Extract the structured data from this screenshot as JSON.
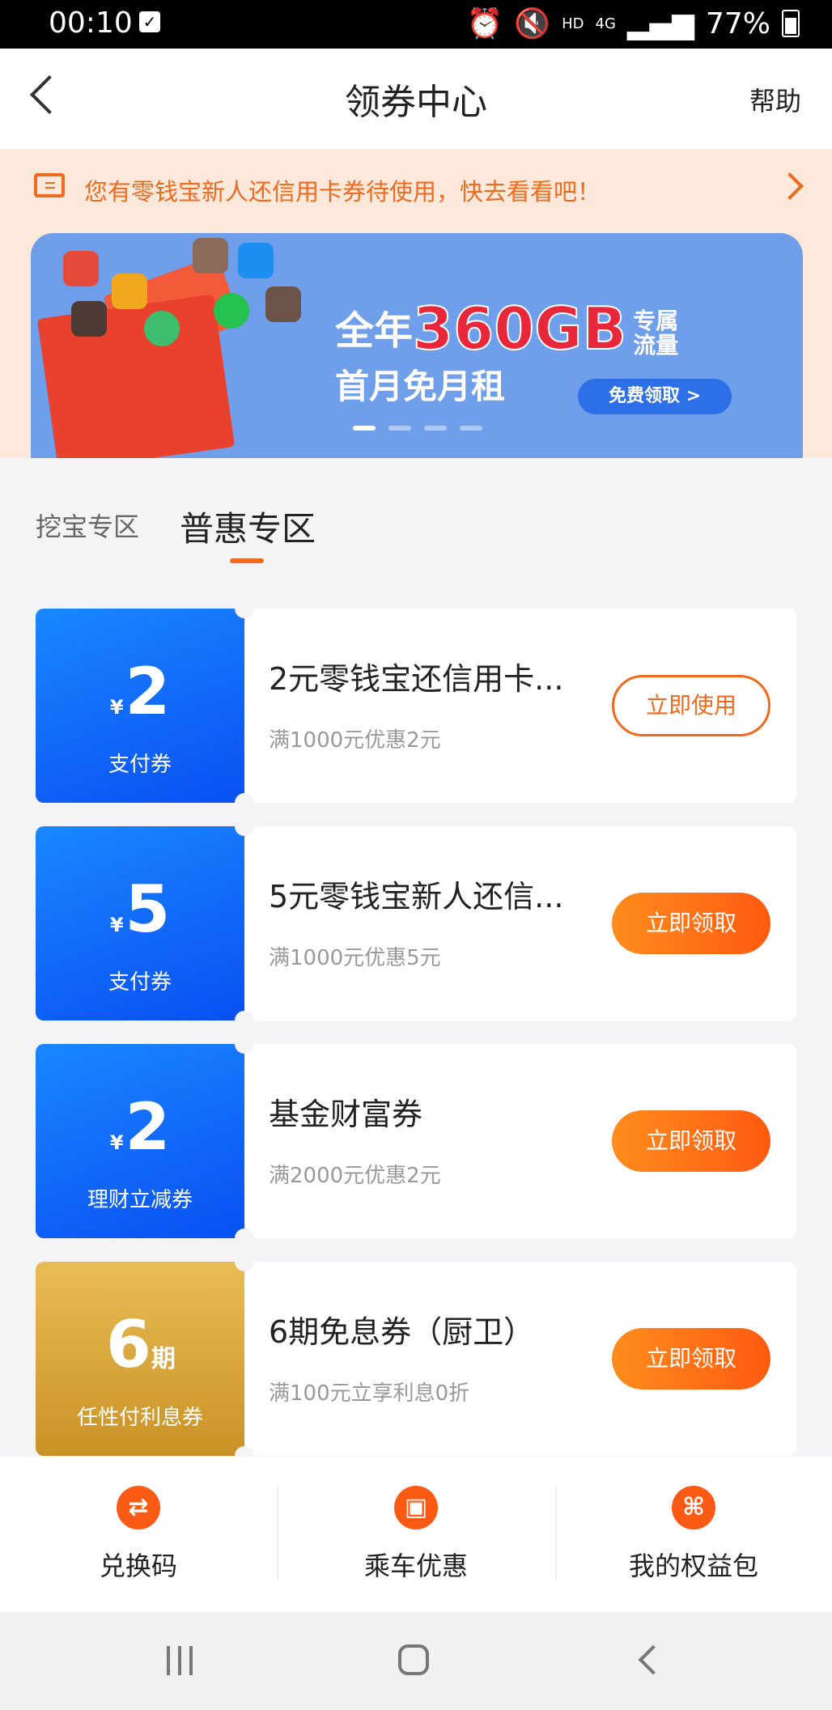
{
  "statusbar": {
    "time": "00:10",
    "battery": "77%",
    "net": "4G",
    "hd": "HD"
  },
  "nav": {
    "title": "领券中心",
    "help": "帮助"
  },
  "notice": {
    "text": "您有零钱宝新人还信用卡券待使用，快去看看吧！"
  },
  "banner": {
    "line1_prefix": "全年",
    "line1_big": "360GB",
    "line1_sub1": "专属",
    "line1_sub2": "流量",
    "line2": "首月免月租",
    "cta": "免费领取 >"
  },
  "tabs": [
    {
      "label": "挖宝专区",
      "active": false
    },
    {
      "label": "普惠专区",
      "active": true
    }
  ],
  "coupons": [
    {
      "currency": "¥",
      "amount": "2",
      "unit": "",
      "kind": "支付券",
      "name": "2元零钱宝还信用卡...",
      "cond": "满1000元优惠2元",
      "btn": "立即使用"
    },
    {
      "currency": "¥",
      "amount": "5",
      "unit": "",
      "kind": "支付券",
      "name": "5元零钱宝新人还信...",
      "cond": "满1000元优惠5元",
      "btn": "立即领取"
    },
    {
      "currency": "¥",
      "amount": "2",
      "unit": "",
      "kind": "理财立减券",
      "name": "基金财富券",
      "cond": "满2000元优惠2元",
      "btn": "立即领取"
    },
    {
      "currency": "",
      "amount": "6",
      "unit": "期",
      "kind": "任性付利息券",
      "name": "6期免息券（厨卫）",
      "cond": "满100元立享利息0折",
      "btn": "立即领取"
    }
  ],
  "bottombar": [
    {
      "label": "兑换码",
      "icon": "exchange-icon"
    },
    {
      "label": "乘车优惠",
      "icon": "bus-icon"
    },
    {
      "label": "我的权益包",
      "icon": "package-icon"
    }
  ],
  "colors": {
    "accent": "#f06a1e",
    "blue": "#0a5bf5",
    "gold": "#d9a53c"
  }
}
